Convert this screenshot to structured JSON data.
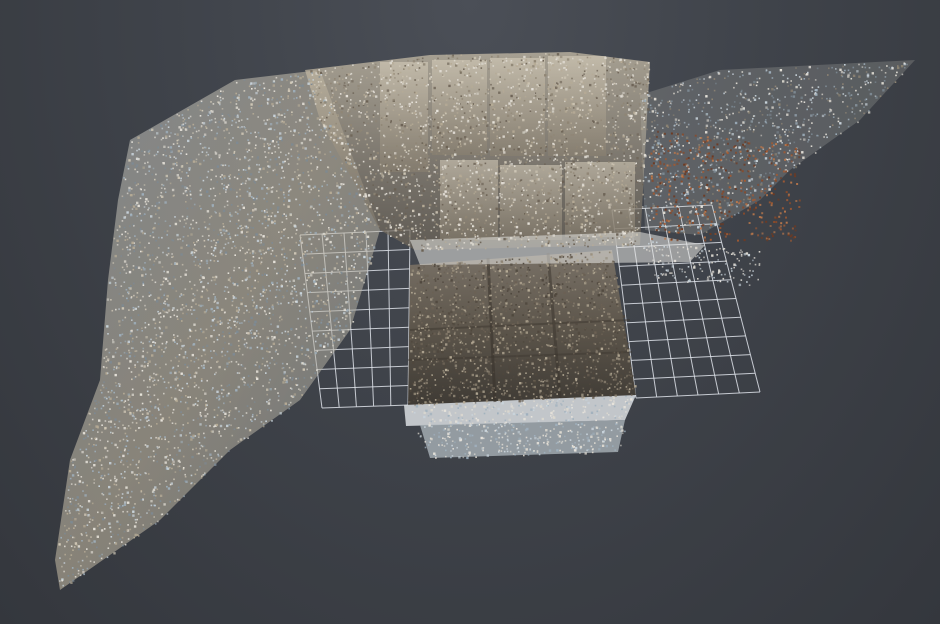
{
  "viewer": {
    "background_top": "#4b4f57",
    "background_bottom": "#34373d",
    "grid_color": "#dfe3ea",
    "cloud_palette": [
      "#cfc7b6",
      "#b6ab96",
      "#8f8574",
      "#6b6154",
      "#4f473d",
      "#dcd8cf",
      "#9fb0bd",
      "#c9d4dc",
      "#7d8a94",
      "#e8e4dc"
    ],
    "rust_palette": [
      "#8a4a2a",
      "#a35a32",
      "#6e3a22",
      "#b9774b"
    ]
  }
}
